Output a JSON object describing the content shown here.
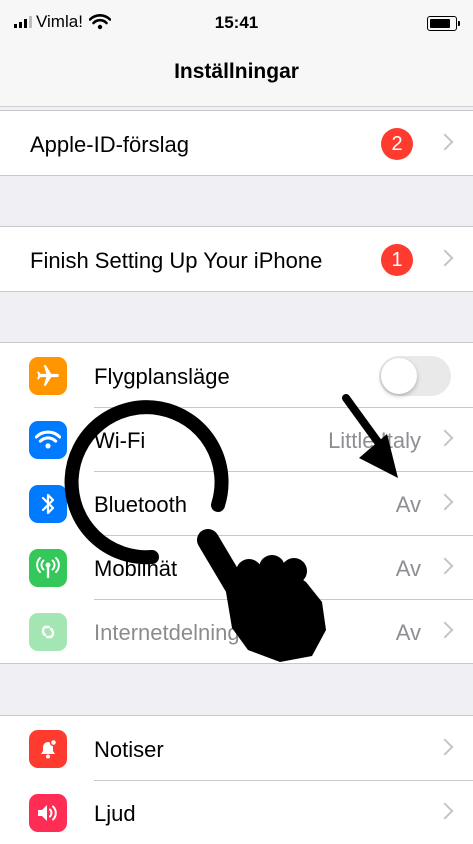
{
  "status": {
    "carrier": "Vimla!",
    "time": "15:41"
  },
  "nav": {
    "title": "Inställningar"
  },
  "suggestions": {
    "label": "Apple-ID-förslag",
    "badge": "2"
  },
  "setup": {
    "label": "Finish Setting Up Your iPhone",
    "badge": "1"
  },
  "connectivity": [
    {
      "label": "Flygplansläge",
      "icon": "airplane-icon",
      "color": "#ff9500",
      "toggle": false
    },
    {
      "label": "Wi-Fi",
      "value": "Little Italy",
      "icon": "wifi-icon",
      "color": "#007aff"
    },
    {
      "label": "Bluetooth",
      "value": "Av",
      "icon": "bluetooth-icon",
      "color": "#007aff"
    },
    {
      "label": "Mobilnät",
      "value": "Av",
      "icon": "antenna-icon",
      "color": "#34c759"
    },
    {
      "label": "Internetdelning",
      "value": "Av",
      "icon": "hotspot-icon",
      "color": "#34c759"
    }
  ],
  "notifications": [
    {
      "label": "Notiser",
      "icon": "bell-icon",
      "color": "#ff3b30"
    },
    {
      "label": "Ljud",
      "icon": "speaker-icon",
      "color": "#ff2d55"
    }
  ],
  "annotation": {
    "arrow": "arrow-icon",
    "cursor": "hand-pointer-icon"
  }
}
